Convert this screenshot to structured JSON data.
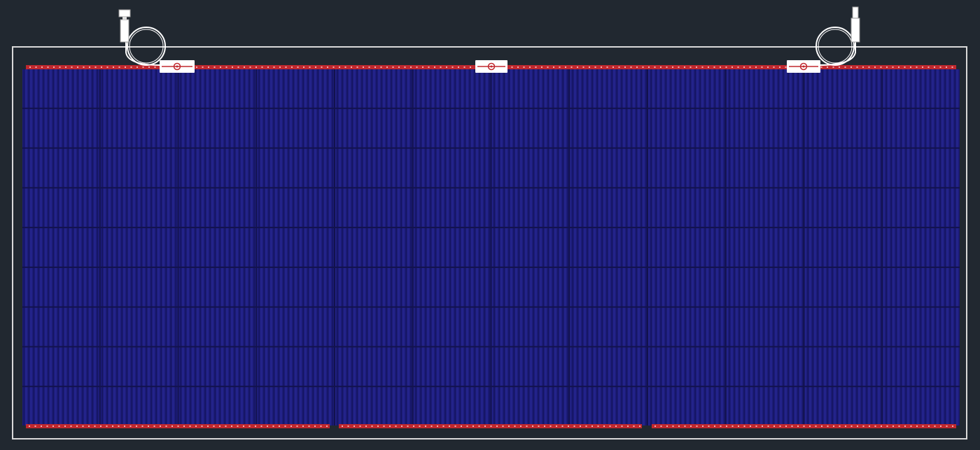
{
  "drawing": {
    "panel": {
      "cell_grid": {
        "columns": 12,
        "rows": 9
      },
      "bus_bar_groups_bottom": 3,
      "junction_boxes": 3,
      "cable_connectors": 2
    },
    "colors": {
      "background": "#212830",
      "frame": "#d9d9d9",
      "cell": "#1c1c78",
      "cell_stripe": "#27288f",
      "cell_gap": "#12124e",
      "bus_bar": "#c0282e",
      "hardware": "#ffffff"
    }
  }
}
